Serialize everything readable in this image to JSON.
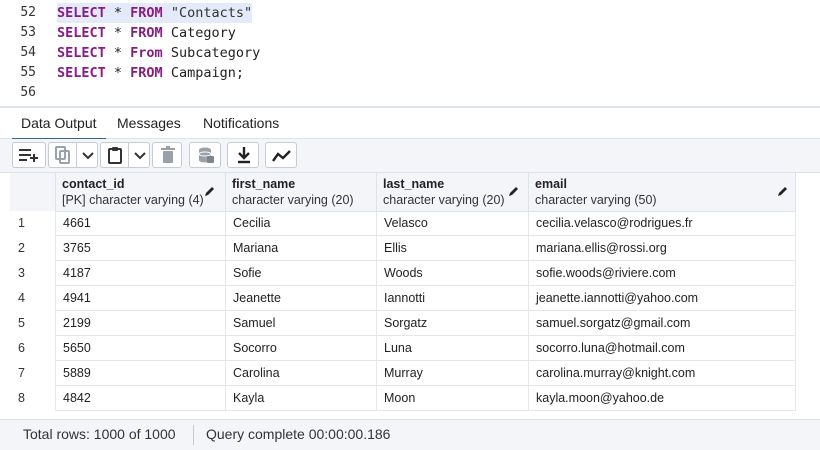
{
  "editor": {
    "lines": [
      {
        "num": "52",
        "kw1": "SELECT",
        "star": " * ",
        "kw2": "FROM",
        "rest": " \"Contacts\""
      },
      {
        "num": "53",
        "kw1": "SELECT",
        "star": " * ",
        "kw2": "FROM",
        "rest": " Category"
      },
      {
        "num": "54",
        "kw1": "SELECT",
        "star": " * ",
        "kw2": "From",
        "rest": " Subcategory"
      },
      {
        "num": "55",
        "kw1": "SELECT",
        "star": " * ",
        "kw2": "FROM",
        "rest": " Campaign;"
      },
      {
        "num": "56",
        "kw1": "",
        "star": "",
        "kw2": "",
        "rest": ""
      }
    ]
  },
  "tabs": [
    {
      "label": "Data Output",
      "active": true
    },
    {
      "label": "Messages",
      "active": false
    },
    {
      "label": "Notifications",
      "active": false
    }
  ],
  "toolbar": {
    "icons": [
      "add-row-icon",
      "copy-icon",
      "chevron-down-icon",
      "paste-icon",
      "chevron-down-icon",
      "delete-icon",
      "save-data-icon",
      "download-icon",
      "graph-icon"
    ]
  },
  "grid": {
    "columns": [
      {
        "name": "contact_id",
        "type": "[PK] character varying (4)"
      },
      {
        "name": "first_name",
        "type": "character varying (20)"
      },
      {
        "name": "last_name",
        "type": "character varying (20)"
      },
      {
        "name": "email",
        "type": "character varying (50)"
      }
    ],
    "rows": [
      [
        "1",
        "4661",
        "Cecilia",
        "Velasco",
        "cecilia.velasco@rodrigues.fr"
      ],
      [
        "2",
        "3765",
        "Mariana",
        "Ellis",
        "mariana.ellis@rossi.org"
      ],
      [
        "3",
        "4187",
        "Sofie",
        "Woods",
        "sofie.woods@riviere.com"
      ],
      [
        "4",
        "4941",
        "Jeanette",
        "Iannotti",
        "jeanette.iannotti@yahoo.com"
      ],
      [
        "5",
        "2199",
        "Samuel",
        "Sorgatz",
        "samuel.sorgatz@gmail.com"
      ],
      [
        "6",
        "5650",
        "Socorro",
        "Luna",
        "socorro.luna@hotmail.com"
      ],
      [
        "7",
        "5889",
        "Carolina",
        "Murray",
        "carolina.murray@knight.com"
      ],
      [
        "8",
        "4842",
        "Kayla",
        "Moon",
        "kayla.moon@yahoo.de"
      ]
    ]
  },
  "status": {
    "total_rows": "Total rows: 1000 of 1000",
    "query": "Query complete 00:00:00.186"
  },
  "colors": {
    "keyword": "#8a1a86",
    "accent": "#326690",
    "panel_bg": "#f3f5f8",
    "border": "#dde3ea"
  }
}
